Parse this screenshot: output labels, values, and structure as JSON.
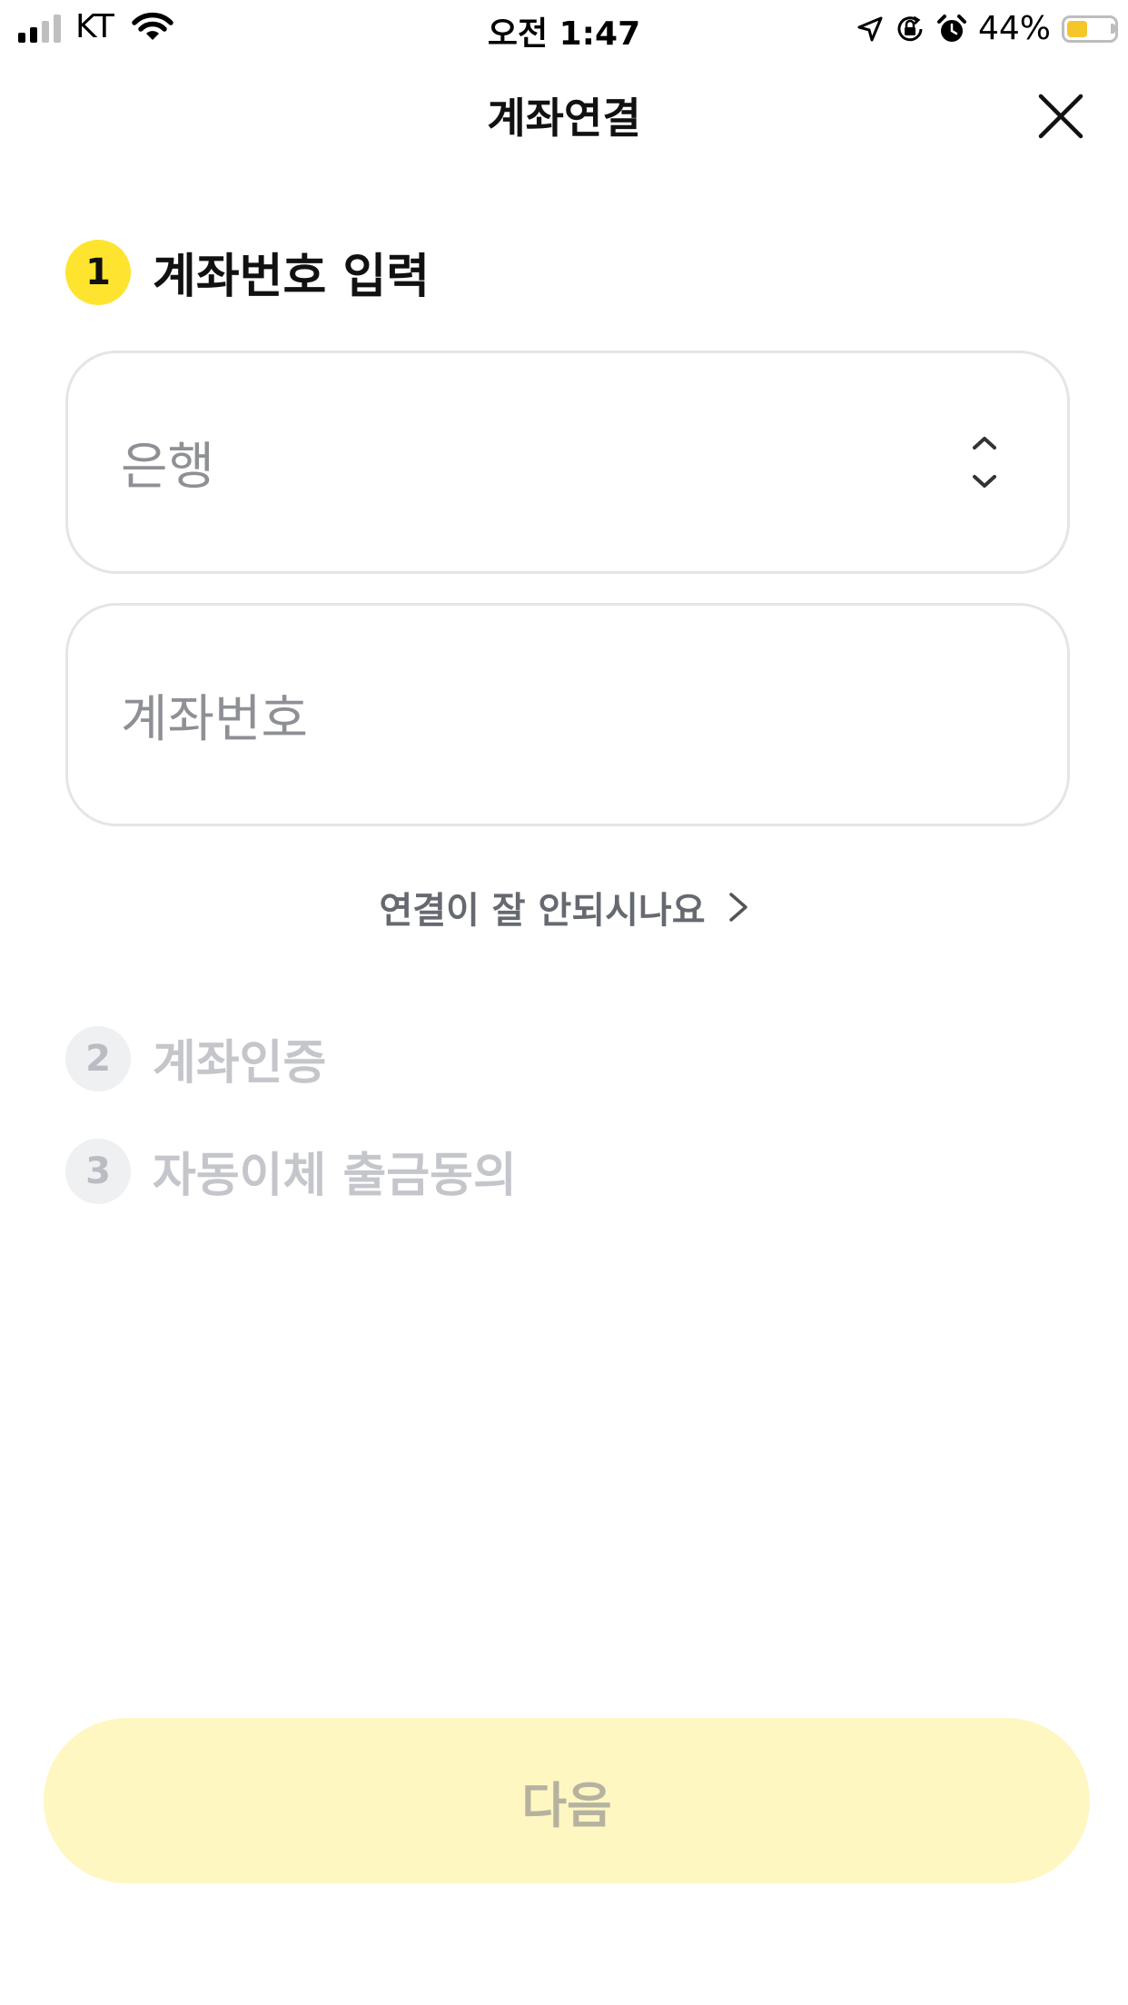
{
  "status_bar": {
    "carrier": "KT",
    "time": "오전 1:47",
    "battery_percent": "44%",
    "battery_level": 0.44,
    "icons": [
      "signal-icon",
      "wifi-icon",
      "location-icon",
      "orientation-lock-icon",
      "alarm-icon",
      "battery-icon"
    ]
  },
  "header": {
    "title": "계좌연결",
    "close_icon": "close-icon"
  },
  "steps": [
    {
      "number": "1",
      "label": "계좌번호 입력",
      "state": "active"
    },
    {
      "number": "2",
      "label": "계좌인증",
      "state": "inactive"
    },
    {
      "number": "3",
      "label": "자동이체 출금동의",
      "state": "inactive"
    }
  ],
  "form": {
    "bank_select": {
      "placeholder": "은행",
      "value": "",
      "icon": "chevron-up-down-icon"
    },
    "account_input": {
      "placeholder": "계좌번호",
      "value": ""
    }
  },
  "help": {
    "label": "연결이 잘 안되시나요",
    "icon": "chevron-right-icon"
  },
  "footer": {
    "next_label": "다음",
    "enabled": false
  },
  "colors": {
    "accent": "#fee42f",
    "accent_disabled": "#fef7c2",
    "inactive_badge": "#eff0f2",
    "field_border": "#e4e5e8",
    "placeholder_text": "#8e9095"
  }
}
